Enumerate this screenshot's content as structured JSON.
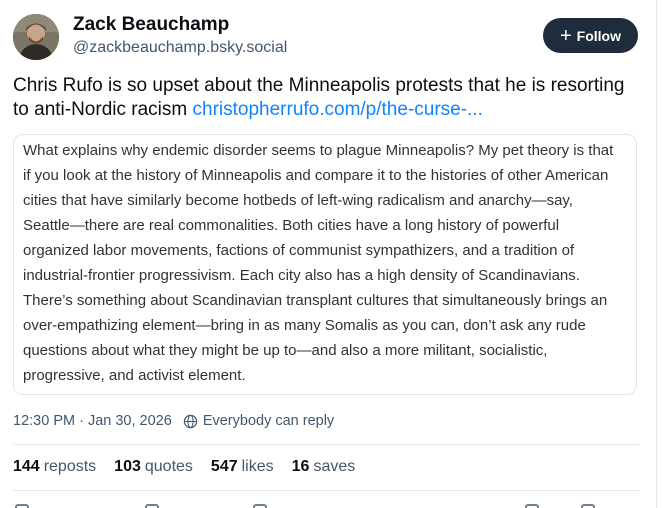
{
  "author": {
    "name": "Zack Beauchamp",
    "handle": "@zackbeauchamp.bsky.social",
    "follow_label": "Follow"
  },
  "post": {
    "text": "Chris Rufo is so upset about the Minneapolis protests that he is resorting to anti-Nordic racism ",
    "link_text": "christopherrufo.com/p/the-curse-..."
  },
  "quote": {
    "text": "What explains why endemic disorder seems to plague Minneapolis? My pet theory is that if you look at the history of Minneapolis and compare it to the histories of other American cities that have similarly become hotbeds of left-wing radicalism and anarchy—say, Seattle—there are real commonalities. Both cities have a long history of powerful organized labor movements, factions of communist sympathizers, and a tradition of industrial-frontier progressivism. Each city also has a high density of Scandinavians. There’s something about Scandinavian transplant cultures that simultaneously brings an over-empathizing element—bring in as many Somalis as you can, don’t ask any rude questions about what they might be up to—and also a more militant, socialistic, progressive, and activist element."
  },
  "meta": {
    "timestamp": "12:30 PM · Jan 30, 2026",
    "reply_setting": "Everybody can reply"
  },
  "stats": {
    "reposts_count": "144",
    "reposts_label": "reposts",
    "quotes_count": "103",
    "quotes_label": "quotes",
    "likes_count": "547",
    "likes_label": "likes",
    "saves_count": "16",
    "saves_label": "saves"
  },
  "colors": {
    "link": "#1083fe",
    "follow_button": "#1f2c3b",
    "secondary_text": "#42576c"
  },
  "icons": [
    "plus-icon",
    "globe-icon"
  ]
}
